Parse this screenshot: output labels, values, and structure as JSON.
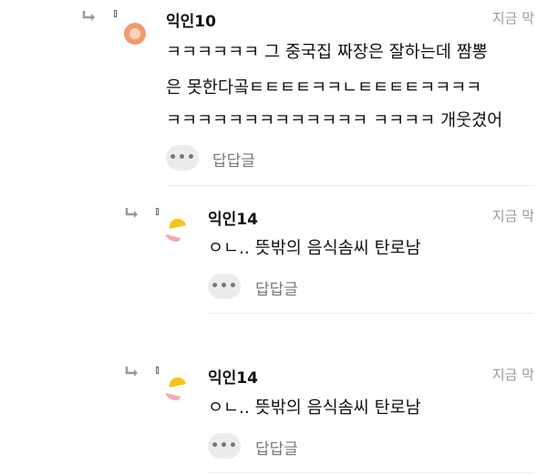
{
  "comments": [
    {
      "author": "익인10",
      "time": "지금 막",
      "lines": [
        "ㅋㅋㅋㅋㅋㅋ 그 중국집 짜장은 잘하는데 짬뽕",
        "은 못한다곸ㅌㅌㅌㅌㅋㅋㄴㅌㅌㅌㅌㅋㅋㅋㅋ",
        "ㅋㅋㅋㅋㅋㅋㅋㅋㅋㅋㅋㅋㅋ ㅋㅋㅋㅋ 개웃겼어"
      ],
      "reply_label": "답답글",
      "avatar_color": "#f29b6e"
    },
    {
      "author": "익인14",
      "time": "지금 막",
      "lines": [
        "ㅇㄴ.. 뜻밖의 음식솜씨 탄로남"
      ],
      "reply_label": "답답글",
      "avatar_colors": [
        "#f7c51a",
        "#f4a8b8"
      ]
    },
    {
      "author": "익인14",
      "time": "지금 막",
      "lines": [
        "ㅇㄴ.. 뜻밖의 음식솜씨 탄로남"
      ],
      "reply_label": "답답글",
      "avatar_colors": [
        "#f7c51a",
        "#f4a8b8"
      ]
    }
  ],
  "more_symbol": "•••"
}
